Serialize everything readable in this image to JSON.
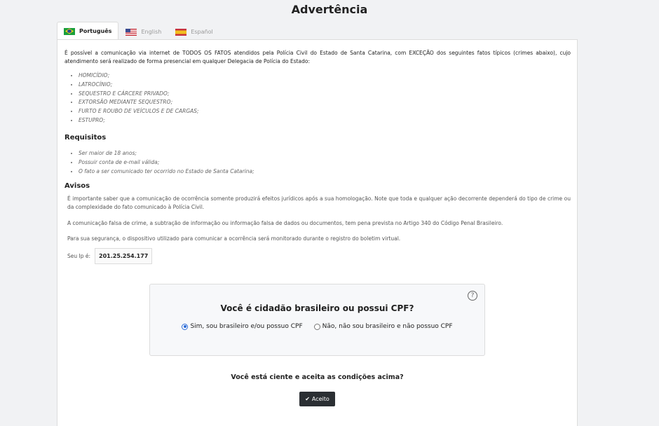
{
  "page": {
    "title": "Advertência"
  },
  "tabs": [
    {
      "label": "Português",
      "flag": "brazil-flag-icon",
      "active": true
    },
    {
      "label": "English",
      "flag": "usa-flag-icon",
      "active": false
    },
    {
      "label": "Español",
      "flag": "spain-flag-icon",
      "active": false
    }
  ],
  "intro": "É possível a comunicação via internet de TODOS OS FATOS atendidos pela Polícia Civil do Estado de Santa Catarina, com EXCEÇÃO dos seguintes fatos típicos (crimes abaixo), cujo atendimento será realizado de forma presencial em qualquer Delegacia de Polícia do Estado:",
  "crimes": [
    "HOMICÍDIO;",
    "LATROCÍNIO;",
    "SEQUESTRO E CÁRCERE PRIVADO;",
    "EXTORSÃO MEDIANTE SEQUESTRO;",
    "FURTO E ROUBO DE VEÍCULOS E DE CARGAS;",
    "ESTUPRO;"
  ],
  "requirements": {
    "heading": "Requisitos",
    "items": [
      "Ser maior de 18 anos;",
      "Possuir conta de e-mail válida;",
      "O fato a ser comunicado ter ocorrido no Estado de Santa Catarina;"
    ]
  },
  "notices": {
    "heading": "Avisos",
    "paragraphs": [
      "É importante saber que a comunicação de ocorrência somente produzirá efeitos jurídicos após a sua homologação. Note que toda e qualquer ação decorrente dependerá do tipo de crime ou da complexidade do fato comunicado à Polícia Civil.",
      "A comunicação falsa de crime, a subtração de informação ou informação falsa de dados ou documentos, tem pena prevista no Artigo 340 do Código Penal Brasileiro.",
      "Para sua segurança, o dispositivo utilizado para comunicar a ocorrência será monitorado durante o registro do boletim virtual."
    ]
  },
  "ip": {
    "label": "Seu Ip é:",
    "value": "201.25.254.177"
  },
  "cpf": {
    "help": "?",
    "question": "Você é cidadão brasileiro ou possui CPF?",
    "options": [
      {
        "label": "Sim, sou brasileiro e/ou possuo CPF",
        "checked": true
      },
      {
        "label": "Não, não sou brasileiro e não possuo CPF",
        "checked": false
      }
    ]
  },
  "accept": {
    "question": "Você está ciente e aceita as condições acima?",
    "button_label": "Aceito",
    "icon": "check-icon"
  }
}
